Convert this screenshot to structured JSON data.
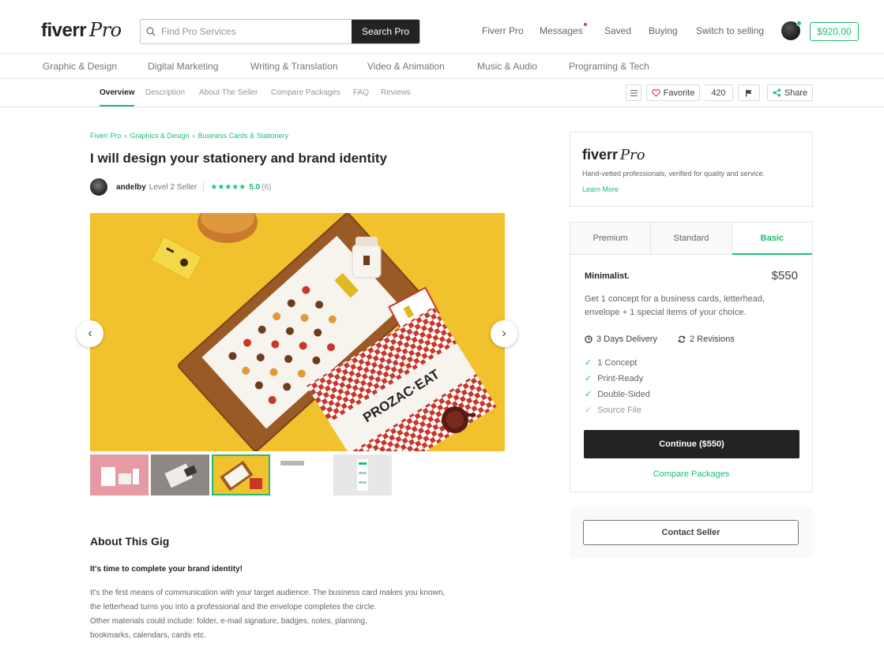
{
  "header": {
    "logo_text": "fiverr",
    "logo_pro": "Pro",
    "search_placeholder": "Find Pro Services",
    "search_button": "Search Pro",
    "nav": [
      "Fiverr Pro",
      "Messages",
      "Saved",
      "Buying",
      "Switch to selling"
    ],
    "balance": "$920.00"
  },
  "categories": [
    "Graphic & Design",
    "Digital Marketing",
    "Writing & Translation",
    "Video & Animation",
    "Music & Audio",
    "Programing & Tech"
  ],
  "subnav": {
    "items": [
      "Overview",
      "Description",
      "About The Seller",
      "Compare Packages",
      "FAQ",
      "Reviews"
    ],
    "active": "Overview",
    "favorite_label": "Favorite",
    "favorite_count": "420",
    "share_label": "Share"
  },
  "breadcrumb": [
    "Fiverr Pro",
    "Graphics & Design",
    "Business Cards & Stationery"
  ],
  "gig": {
    "title": "I will design your stationery and brand identity",
    "seller_name": "andelby",
    "seller_level": "Level 2 Seller",
    "stars": "★★★★★",
    "rating": "5.0",
    "review_count": "(6)"
  },
  "about": {
    "title": "About This Gig",
    "subtitle": "It's time to complete your brand identity!",
    "lines": [
      "It's the first means of communication with your target audience. The business card makes you known,",
      "the letterhead turns you into a professional and the envelope completes the circle.",
      "Other materials could include: folder, e-mail signature, badges, notes, planning,",
      "bookmarks, calendars, cards etc."
    ]
  },
  "pro_card": {
    "logo_text": "fiverr",
    "logo_pro": "Pro",
    "description": "Hand-vetted professionals, verified for quality and service.",
    "learn_more": "Learn More"
  },
  "package": {
    "tabs": [
      "Premium",
      "Standard",
      "Basic"
    ],
    "active_tab": "Basic",
    "name": "Minimalist.",
    "price": "$550",
    "description_lines": [
      "Get 1 concept for a business cards, letterhead,",
      "envelope + 1 special items of your choice."
    ],
    "delivery": "3 Days Delivery",
    "revisions": "2 Revisions",
    "features": [
      {
        "label": "1 Concept",
        "included": true
      },
      {
        "label": "Print-Ready",
        "included": true
      },
      {
        "label": "Double-Sided",
        "included": true
      },
      {
        "label": "Source File",
        "included": false
      }
    ],
    "continue_label": "Continue ($550)",
    "compare_label": "Compare Packages"
  },
  "contact_label": "Contact Seller",
  "hero_prozac": "PROZAC·EAT",
  "colors": {
    "brand_green": "#1dbf73",
    "dark": "#222325",
    "hero_yellow": "#f2c12e"
  }
}
